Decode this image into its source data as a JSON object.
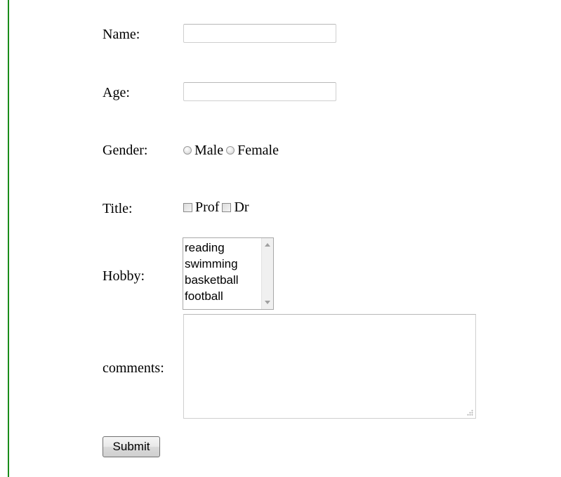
{
  "form": {
    "name_label": "Name:",
    "name_value": "",
    "age_label": "Age:",
    "age_value": "",
    "gender_label": "Gender:",
    "gender_options": [
      "Male",
      "Female"
    ],
    "title_label": "Title:",
    "title_options": [
      "Prof",
      "Dr"
    ],
    "hobby_label": "Hobby:",
    "hobby_options": [
      "reading",
      "swimming",
      "basketball",
      "football"
    ],
    "comments_label": "comments:",
    "comments_value": "",
    "submit_label": "Submit"
  },
  "colors": {
    "left_rule": "#1a8c1a",
    "background": "#ffffff"
  }
}
